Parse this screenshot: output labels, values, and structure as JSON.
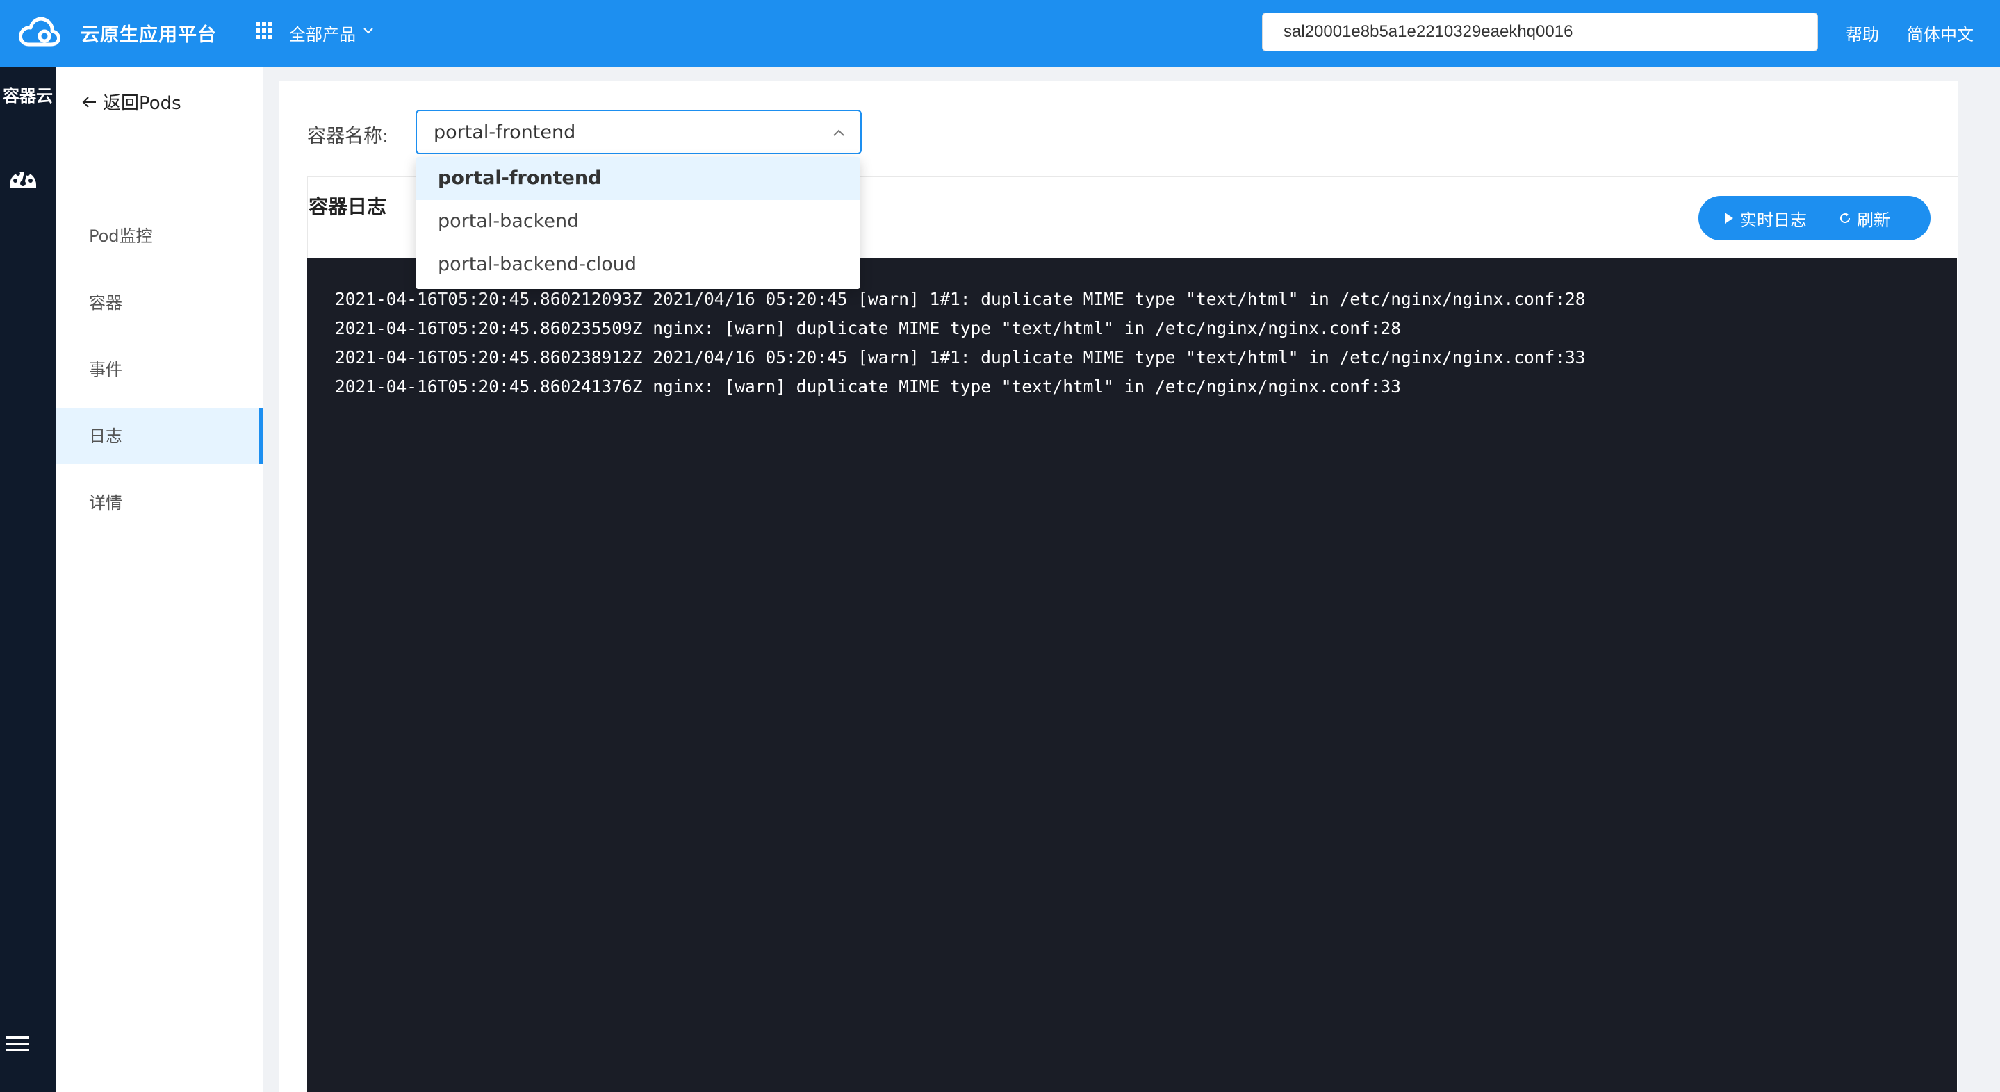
{
  "header": {
    "brand": "云原生应用平台",
    "products_label": "全部产品",
    "account_value": "sal20001e8b5a1e2210329eaekhq0016",
    "help_label": "帮助",
    "language_label": "简体中文"
  },
  "rail": {
    "title": "容器云"
  },
  "subnav": {
    "back_label": "返回Pods",
    "items": [
      {
        "label": "Pod监控"
      },
      {
        "label": "容器"
      },
      {
        "label": "事件"
      },
      {
        "label": "日志"
      },
      {
        "label": "详情"
      }
    ]
  },
  "main": {
    "container_label": "容器名称:",
    "selected_container": "portal-frontend",
    "log_title": "容器日志",
    "live_log_label": "实时日志",
    "refresh_label": "刷新",
    "log_lines": [
      "2021-04-16T05:20:45.860212093Z 2021/04/16 05:20:45 [warn] 1#1: duplicate MIME type \"text/html\" in /etc/nginx/nginx.conf:28",
      "2021-04-16T05:20:45.860235509Z nginx: [warn] duplicate MIME type \"text/html\" in /etc/nginx/nginx.conf:28",
      "2021-04-16T05:20:45.860238912Z 2021/04/16 05:20:45 [warn] 1#1: duplicate MIME type \"text/html\" in /etc/nginx/nginx.conf:33",
      "2021-04-16T05:20:45.860241376Z nginx: [warn] duplicate MIME type \"text/html\" in /etc/nginx/nginx.conf:33"
    ]
  },
  "dropdown": {
    "options": [
      {
        "label": "portal-frontend"
      },
      {
        "label": "portal-backend"
      },
      {
        "label": "portal-backend-cloud"
      }
    ]
  },
  "colors": {
    "primary": "#1d8ff0",
    "rail_bg": "#0f1a2b",
    "console_bg": "#1a1d26",
    "active_bg": "#e6f4ff"
  }
}
